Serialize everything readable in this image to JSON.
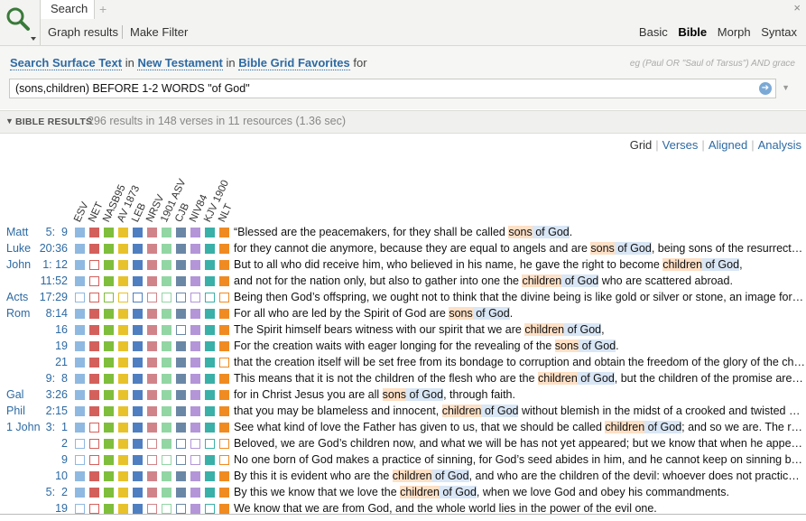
{
  "tab": {
    "label": "Search"
  },
  "toolbar": {
    "graph_results": "Graph results",
    "make_filter": "Make Filter"
  },
  "modes": [
    "Basic",
    "Bible",
    "Morph",
    "Syntax"
  ],
  "query": {
    "search": "Search",
    "surface": "Surface Text",
    "in1": "in",
    "scope": "New Testament",
    "in2": "in",
    "collection": "Bible Grid Favorites",
    "for": "for",
    "hint": "eg (Paul OR \"Saul of Tarsus\") AND grace",
    "value": "(sons,children) BEFORE 1-2 WORDS \"of God\""
  },
  "results": {
    "header": "BIBLE RESULTS",
    "summary": "296 results in 148 verses in 11 resources (1.36 sec)"
  },
  "views": [
    "Grid",
    "Verses",
    "Aligned",
    "Analysis"
  ],
  "versions": [
    "ESV",
    "NET",
    "NASB95",
    "AV 1873",
    "LEB",
    "NRSV",
    "1901 ASV",
    "CJB",
    "NIV84",
    "KJV 1900",
    "NLT"
  ],
  "colors": {
    "ESV": "#8fb9e0",
    "NET": "#d4605c",
    "NASB95": "#7fbe3c",
    "AV 1873": "#e8c22a",
    "LEB": "#4f7fc1",
    "NRSV": "#d0848a",
    "1901 ASV": "#92d6a4",
    "CJB": "#6b87a6",
    "NIV84": "#b395d8",
    "KJV 1900": "#3ab0a8",
    "NLT": "#f08b22"
  },
  "rows": [
    {
      "book": "Matt",
      "ref": "5:  9",
      "grid": [
        1,
        1,
        1,
        1,
        1,
        1,
        1,
        1,
        1,
        1,
        1
      ],
      "segs": [
        [
          "“Blessed are the peacemakers, for they shall be called ",
          ""
        ],
        [
          "sons",
          "o"
        ],
        [
          " of God",
          "b"
        ],
        [
          ".",
          ""
        ]
      ]
    },
    {
      "book": "Luke",
      "ref": "20:36",
      "grid": [
        1,
        1,
        1,
        1,
        1,
        1,
        1,
        1,
        1,
        1,
        1
      ],
      "segs": [
        [
          "for they cannot die anymore, because they are equal to angels and are ",
          ""
        ],
        [
          "sons",
          "o"
        ],
        [
          " of God",
          "b"
        ],
        [
          ", being sons of the resurrection.",
          ""
        ]
      ]
    },
    {
      "book": "John",
      "ref": "1: 12",
      "grid": [
        1,
        0,
        1,
        1,
        1,
        1,
        1,
        1,
        1,
        1,
        1
      ],
      "segs": [
        [
          "But to all who did receive him, who believed in his name, he gave the right to become ",
          ""
        ],
        [
          "children",
          "o"
        ],
        [
          " of God",
          "b"
        ],
        [
          ",",
          ""
        ]
      ]
    },
    {
      "book": "",
      "ref": "11:52",
      "grid": [
        1,
        0,
        1,
        1,
        1,
        1,
        1,
        1,
        1,
        1,
        1
      ],
      "segs": [
        [
          "and not for the nation only, but also to gather into one the ",
          ""
        ],
        [
          "children",
          "o"
        ],
        [
          " of God",
          "b"
        ],
        [
          " who are scattered abroad.",
          ""
        ]
      ]
    },
    {
      "book": "Acts",
      "ref": "17:29",
      "grid": [
        0,
        0,
        0,
        0,
        0,
        0,
        0,
        0,
        0,
        0,
        0
      ],
      "segs": [
        [
          "Being then God’s offspring, we ought not to think that the divine being is like gold or silver or stone, an image formed by the art and imagination of man.",
          ""
        ]
      ]
    },
    {
      "book": "Rom",
      "ref": "8:14",
      "grid": [
        1,
        1,
        1,
        1,
        1,
        1,
        1,
        1,
        1,
        1,
        1
      ],
      "segs": [
        [
          "For all who are led by the Spirit of God are ",
          ""
        ],
        [
          "sons",
          "o"
        ],
        [
          " of God",
          "b"
        ],
        [
          ".",
          ""
        ]
      ]
    },
    {
      "book": "",
      "ref": "16",
      "grid": [
        1,
        1,
        1,
        1,
        1,
        1,
        1,
        0,
        1,
        1,
        1
      ],
      "segs": [
        [
          "The Spirit himself bears witness with our spirit that we are ",
          ""
        ],
        [
          "children",
          "o"
        ],
        [
          " of God",
          "b"
        ],
        [
          ",",
          ""
        ]
      ]
    },
    {
      "book": "",
      "ref": "19",
      "grid": [
        1,
        1,
        1,
        1,
        1,
        1,
        1,
        1,
        1,
        1,
        1
      ],
      "segs": [
        [
          "For the creation waits with eager longing for the revealing of the ",
          ""
        ],
        [
          "sons",
          "o"
        ],
        [
          " of God",
          "b"
        ],
        [
          ".",
          ""
        ]
      ]
    },
    {
      "book": "",
      "ref": "21",
      "grid": [
        1,
        1,
        1,
        1,
        1,
        1,
        1,
        1,
        1,
        1,
        0
      ],
      "segs": [
        [
          "that the creation itself will be set free from its bondage to corruption and obtain the freedom of the glory of the children of God.",
          ""
        ]
      ]
    },
    {
      "book": "",
      "ref": "9:  8",
      "grid": [
        1,
        1,
        1,
        1,
        1,
        1,
        1,
        1,
        1,
        1,
        1
      ],
      "segs": [
        [
          "This means that it is not the children of the flesh who are the ",
          ""
        ],
        [
          "children",
          "o"
        ],
        [
          " of God",
          "b"
        ],
        [
          ", but the children of the promise are counted as offspring.",
          ""
        ]
      ]
    },
    {
      "book": "Gal",
      "ref": "3:26",
      "grid": [
        1,
        1,
        1,
        1,
        1,
        1,
        1,
        1,
        1,
        1,
        1
      ],
      "segs": [
        [
          "for in Christ Jesus you are all ",
          ""
        ],
        [
          "sons",
          "o"
        ],
        [
          " of God",
          "b"
        ],
        [
          ", through faith.",
          ""
        ]
      ]
    },
    {
      "book": "Phil",
      "ref": "2:15",
      "grid": [
        1,
        1,
        1,
        1,
        1,
        1,
        1,
        1,
        1,
        1,
        1
      ],
      "segs": [
        [
          "that you may be blameless and innocent, ",
          ""
        ],
        [
          "children",
          "o"
        ],
        [
          " of God",
          "b"
        ],
        [
          " without blemish in the midst of a crooked and twisted generation.",
          ""
        ]
      ]
    },
    {
      "book": "1 John",
      "ref": "3:  1",
      "grid": [
        1,
        0,
        1,
        1,
        1,
        1,
        1,
        1,
        1,
        1,
        1
      ],
      "segs": [
        [
          "See what kind of love the Father has given to us, that we should be called ",
          ""
        ],
        [
          "children",
          "o"
        ],
        [
          " of God",
          "b"
        ],
        [
          "; and so we are. The reason why the world does not know us",
          ""
        ]
      ]
    },
    {
      "book": "",
      "ref": "2",
      "grid": [
        0,
        0,
        1,
        1,
        1,
        0,
        1,
        0,
        0,
        0,
        0
      ],
      "segs": [
        [
          "Beloved, we are God’s children now, and what we will be has not yet appeared; but we know that when he appears we shall be like him.",
          ""
        ]
      ]
    },
    {
      "book": "",
      "ref": "9",
      "grid": [
        0,
        0,
        1,
        1,
        1,
        0,
        0,
        0,
        0,
        1,
        0
      ],
      "segs": [
        [
          "No one born of God makes a practice of sinning, for God’s seed abides in him, and he cannot keep on sinning because he has been born of God.",
          ""
        ]
      ]
    },
    {
      "book": "",
      "ref": "10",
      "grid": [
        1,
        1,
        1,
        1,
        1,
        1,
        1,
        1,
        1,
        1,
        1
      ],
      "segs": [
        [
          "By this it is evident who are the ",
          ""
        ],
        [
          "children",
          "o"
        ],
        [
          " of God",
          "b"
        ],
        [
          ", and who are the children of the devil: whoever does not practice righteousness is not of God.",
          ""
        ]
      ]
    },
    {
      "book": "",
      "ref": "5:  2",
      "grid": [
        1,
        1,
        1,
        1,
        1,
        1,
        1,
        1,
        1,
        1,
        1
      ],
      "segs": [
        [
          "By this we know that we love the ",
          ""
        ],
        [
          "children",
          "o"
        ],
        [
          " of God",
          "b"
        ],
        [
          ", when we love God and obey his commandments.",
          ""
        ]
      ]
    },
    {
      "book": "",
      "ref": "19",
      "grid": [
        0,
        0,
        1,
        1,
        1,
        0,
        0,
        0,
        1,
        0,
        1
      ],
      "segs": [
        [
          "We know that we are from God, and the whole world lies in the power of the evil one.",
          ""
        ]
      ]
    }
  ]
}
